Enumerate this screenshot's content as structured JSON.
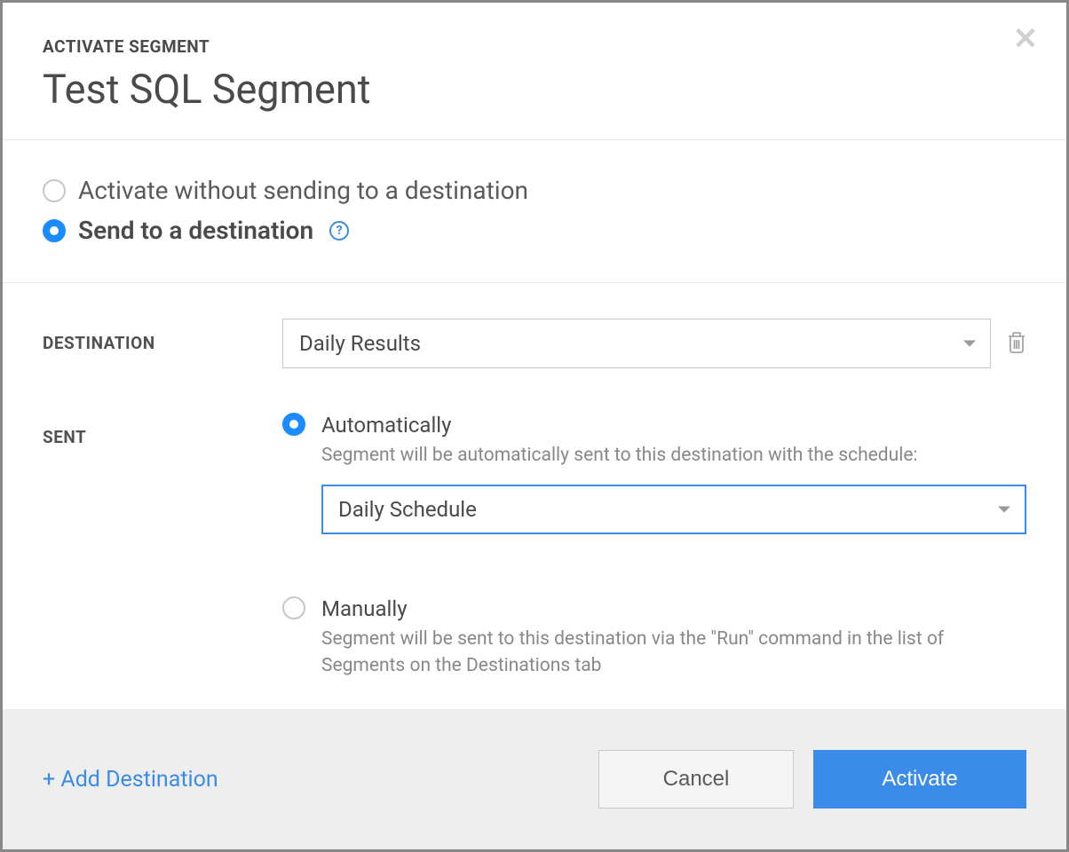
{
  "header": {
    "eyebrow": "ACTIVATE SEGMENT",
    "title": "Test SQL Segment"
  },
  "activation_mode": {
    "without_destination": {
      "label": "Activate without sending to a destination",
      "selected": false
    },
    "send_to_destination": {
      "label": "Send to a destination",
      "selected": true
    }
  },
  "form": {
    "destination_label": "DESTINATION",
    "destination_value": "Daily Results",
    "sent_label": "SENT",
    "sent_options": {
      "automatically": {
        "title": "Automatically",
        "description": "Segment will be automatically sent to this destination with the schedule:",
        "schedule_value": "Daily Schedule",
        "selected": true
      },
      "manually": {
        "title": "Manually",
        "description": "Segment will be sent to this destination via the \"Run\" command in the list of Segments on the Destinations tab",
        "selected": false
      }
    }
  },
  "footer": {
    "add_destination": "+ Add Destination",
    "cancel": "Cancel",
    "activate": "Activate"
  }
}
